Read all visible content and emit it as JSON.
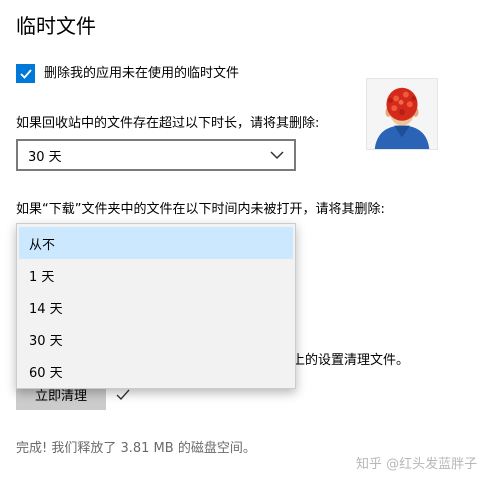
{
  "page": {
    "title": "临时文件"
  },
  "checkbox": {
    "label": "删除我的应用未在使用的临时文件",
    "checked": true
  },
  "recycle_bin": {
    "label": "如果回收站中的文件存在超过以下时长，请将其删除:",
    "selected": "30 天"
  },
  "downloads": {
    "label": "如果“下载”文件夹中的文件在以下时间内未被打开，请将其删除:",
    "options": [
      "从不",
      "1 天",
      "14 天",
      "30 天",
      "60 天"
    ],
    "highlighted": "从不"
  },
  "partial_text": "上的设置清理文件。",
  "clean_button": {
    "label": "立即清理"
  },
  "status": "完成! 我们释放了 3.81 MB 的磁盘空间。",
  "watermark": "知乎 @红头发蓝胖子",
  "colors": {
    "accent": "#0078d7",
    "highlight": "#cce8ff",
    "button": "#cccccc",
    "status_text": "#6a6a6a"
  }
}
